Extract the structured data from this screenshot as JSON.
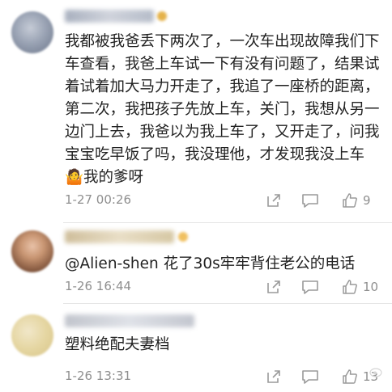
{
  "comments": [
    {
      "text": "我都被我爸丢下两次了，一次车出现故障我们下车查看，我爸上车试一下有没有问题了，结果试着试着加大马力开走了，我追了一座桥的距离，第二次，我把孩子先放上车，关门，我想从另一边门上去，我爸以为我上车了，又开走了，问我宝宝吃早饭了吗，我没理他，才发现我没上车",
      "emoji": "🤷",
      "text_after_emoji": "我的爹呀",
      "time": "1-27 00:26",
      "likes": "9"
    },
    {
      "mention": "@Alien-shen",
      "text": " 花了30s牢牢背住老公的电话",
      "time": "1-26 16:44",
      "likes": "10"
    },
    {
      "text": "塑料绝配夫妻档",
      "time": "1-26 13:31",
      "likes": "13"
    }
  ],
  "icons": {
    "share": "share-icon",
    "reply": "reply-icon",
    "like": "thumbs-up-icon",
    "watermark": "weibo-logo-icon"
  },
  "colors": {
    "text": "#222222",
    "meta": "#8f8f8f",
    "divider": "#e6e6e6"
  }
}
